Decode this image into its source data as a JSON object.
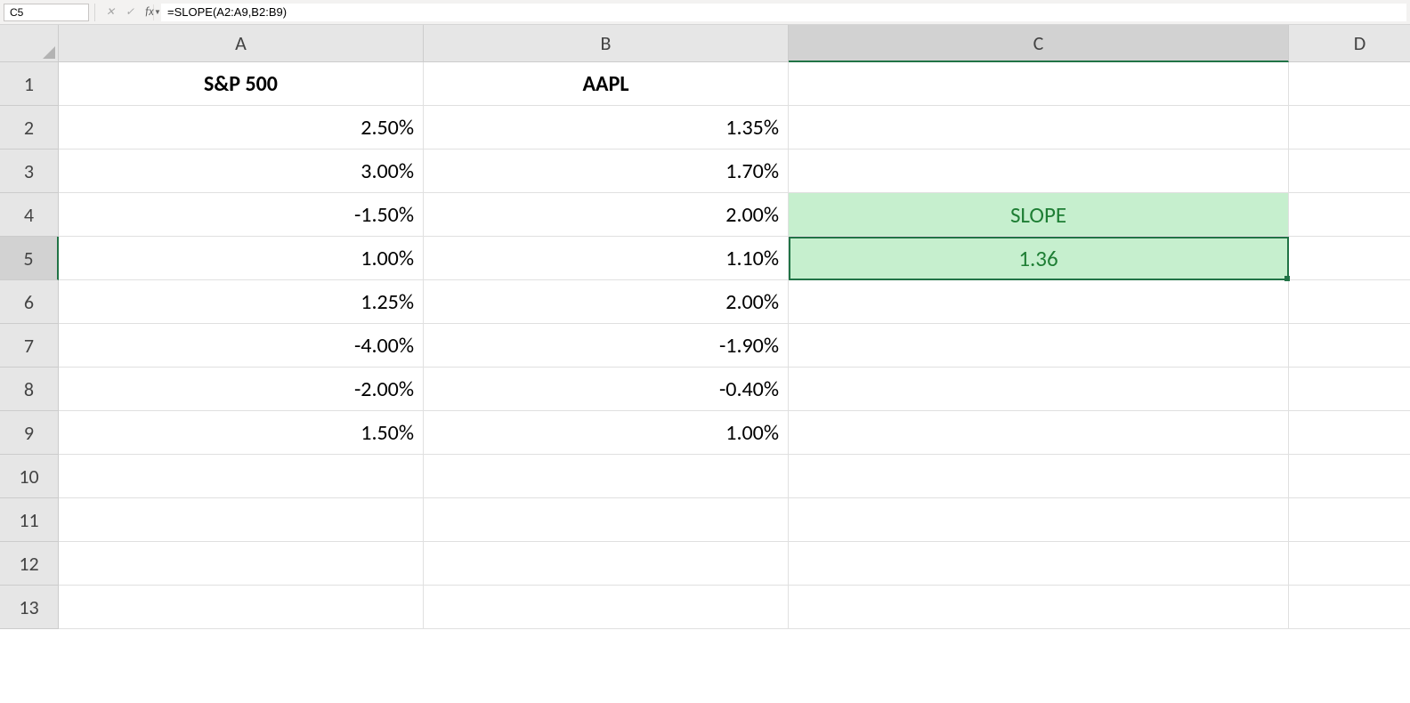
{
  "formula_bar": {
    "name_box": "C5",
    "formula": "=SLOPE(A2:A9,B2:B9)",
    "fx_label": "fx"
  },
  "columns": [
    "A",
    "B",
    "C",
    "D"
  ],
  "row_numbers": [
    "1",
    "2",
    "3",
    "4",
    "5",
    "6",
    "7",
    "8",
    "9",
    "10",
    "11",
    "12",
    "13"
  ],
  "active_cell": "C5",
  "headers": {
    "A": "S&P 500",
    "B": "AAPL"
  },
  "data": {
    "A": [
      "2.50%",
      "3.00%",
      "-1.50%",
      "1.00%",
      "1.25%",
      "-4.00%",
      "-2.00%",
      "1.50%"
    ],
    "B": [
      "1.35%",
      "1.70%",
      "2.00%",
      "1.10%",
      "2.00%",
      "-1.90%",
      "-0.40%",
      "1.00%"
    ]
  },
  "slope": {
    "label": "SLOPE",
    "value": "1.36"
  },
  "chart_data": {
    "type": "table",
    "title": "SLOPE calculation of AAPL vs S&P 500 periodic returns",
    "columns": [
      "S&P 500",
      "AAPL"
    ],
    "rows": [
      [
        0.025,
        0.0135
      ],
      [
        0.03,
        0.017
      ],
      [
        -0.015,
        0.02
      ],
      [
        0.01,
        0.011
      ],
      [
        0.0125,
        0.02
      ],
      [
        -0.04,
        -0.019
      ],
      [
        -0.02,
        -0.004
      ],
      [
        0.015,
        0.01
      ]
    ],
    "computed": {
      "SLOPE(A2:A9,B2:B9)": 1.36
    }
  }
}
